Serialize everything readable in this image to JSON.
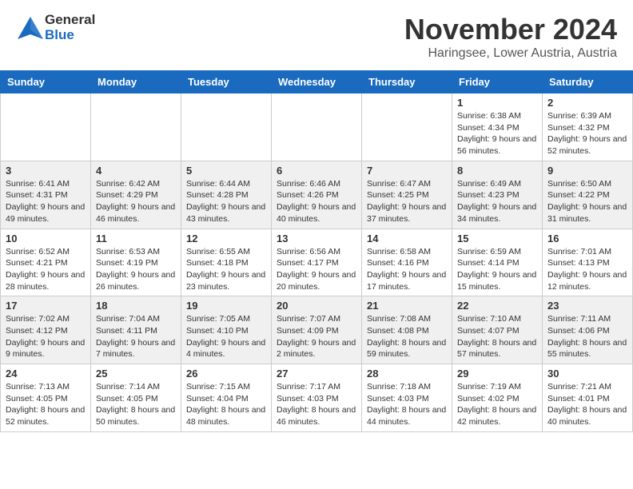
{
  "logo": {
    "general": "General",
    "blue": "Blue"
  },
  "header": {
    "month": "November 2024",
    "location": "Haringsee, Lower Austria, Austria"
  },
  "weekdays": [
    "Sunday",
    "Monday",
    "Tuesday",
    "Wednesday",
    "Thursday",
    "Friday",
    "Saturday"
  ],
  "weeks": [
    [
      {
        "day": "",
        "detail": ""
      },
      {
        "day": "",
        "detail": ""
      },
      {
        "day": "",
        "detail": ""
      },
      {
        "day": "",
        "detail": ""
      },
      {
        "day": "",
        "detail": ""
      },
      {
        "day": "1",
        "detail": "Sunrise: 6:38 AM\nSunset: 4:34 PM\nDaylight: 9 hours and 56 minutes."
      },
      {
        "day": "2",
        "detail": "Sunrise: 6:39 AM\nSunset: 4:32 PM\nDaylight: 9 hours and 52 minutes."
      }
    ],
    [
      {
        "day": "3",
        "detail": "Sunrise: 6:41 AM\nSunset: 4:31 PM\nDaylight: 9 hours and 49 minutes."
      },
      {
        "day": "4",
        "detail": "Sunrise: 6:42 AM\nSunset: 4:29 PM\nDaylight: 9 hours and 46 minutes."
      },
      {
        "day": "5",
        "detail": "Sunrise: 6:44 AM\nSunset: 4:28 PM\nDaylight: 9 hours and 43 minutes."
      },
      {
        "day": "6",
        "detail": "Sunrise: 6:46 AM\nSunset: 4:26 PM\nDaylight: 9 hours and 40 minutes."
      },
      {
        "day": "7",
        "detail": "Sunrise: 6:47 AM\nSunset: 4:25 PM\nDaylight: 9 hours and 37 minutes."
      },
      {
        "day": "8",
        "detail": "Sunrise: 6:49 AM\nSunset: 4:23 PM\nDaylight: 9 hours and 34 minutes."
      },
      {
        "day": "9",
        "detail": "Sunrise: 6:50 AM\nSunset: 4:22 PM\nDaylight: 9 hours and 31 minutes."
      }
    ],
    [
      {
        "day": "10",
        "detail": "Sunrise: 6:52 AM\nSunset: 4:21 PM\nDaylight: 9 hours and 28 minutes."
      },
      {
        "day": "11",
        "detail": "Sunrise: 6:53 AM\nSunset: 4:19 PM\nDaylight: 9 hours and 26 minutes."
      },
      {
        "day": "12",
        "detail": "Sunrise: 6:55 AM\nSunset: 4:18 PM\nDaylight: 9 hours and 23 minutes."
      },
      {
        "day": "13",
        "detail": "Sunrise: 6:56 AM\nSunset: 4:17 PM\nDaylight: 9 hours and 20 minutes."
      },
      {
        "day": "14",
        "detail": "Sunrise: 6:58 AM\nSunset: 4:16 PM\nDaylight: 9 hours and 17 minutes."
      },
      {
        "day": "15",
        "detail": "Sunrise: 6:59 AM\nSunset: 4:14 PM\nDaylight: 9 hours and 15 minutes."
      },
      {
        "day": "16",
        "detail": "Sunrise: 7:01 AM\nSunset: 4:13 PM\nDaylight: 9 hours and 12 minutes."
      }
    ],
    [
      {
        "day": "17",
        "detail": "Sunrise: 7:02 AM\nSunset: 4:12 PM\nDaylight: 9 hours and 9 minutes."
      },
      {
        "day": "18",
        "detail": "Sunrise: 7:04 AM\nSunset: 4:11 PM\nDaylight: 9 hours and 7 minutes."
      },
      {
        "day": "19",
        "detail": "Sunrise: 7:05 AM\nSunset: 4:10 PM\nDaylight: 9 hours and 4 minutes."
      },
      {
        "day": "20",
        "detail": "Sunrise: 7:07 AM\nSunset: 4:09 PM\nDaylight: 9 hours and 2 minutes."
      },
      {
        "day": "21",
        "detail": "Sunrise: 7:08 AM\nSunset: 4:08 PM\nDaylight: 8 hours and 59 minutes."
      },
      {
        "day": "22",
        "detail": "Sunrise: 7:10 AM\nSunset: 4:07 PM\nDaylight: 8 hours and 57 minutes."
      },
      {
        "day": "23",
        "detail": "Sunrise: 7:11 AM\nSunset: 4:06 PM\nDaylight: 8 hours and 55 minutes."
      }
    ],
    [
      {
        "day": "24",
        "detail": "Sunrise: 7:13 AM\nSunset: 4:05 PM\nDaylight: 8 hours and 52 minutes."
      },
      {
        "day": "25",
        "detail": "Sunrise: 7:14 AM\nSunset: 4:05 PM\nDaylight: 8 hours and 50 minutes."
      },
      {
        "day": "26",
        "detail": "Sunrise: 7:15 AM\nSunset: 4:04 PM\nDaylight: 8 hours and 48 minutes."
      },
      {
        "day": "27",
        "detail": "Sunrise: 7:17 AM\nSunset: 4:03 PM\nDaylight: 8 hours and 46 minutes."
      },
      {
        "day": "28",
        "detail": "Sunrise: 7:18 AM\nSunset: 4:03 PM\nDaylight: 8 hours and 44 minutes."
      },
      {
        "day": "29",
        "detail": "Sunrise: 7:19 AM\nSunset: 4:02 PM\nDaylight: 8 hours and 42 minutes."
      },
      {
        "day": "30",
        "detail": "Sunrise: 7:21 AM\nSunset: 4:01 PM\nDaylight: 8 hours and 40 minutes."
      }
    ]
  ]
}
